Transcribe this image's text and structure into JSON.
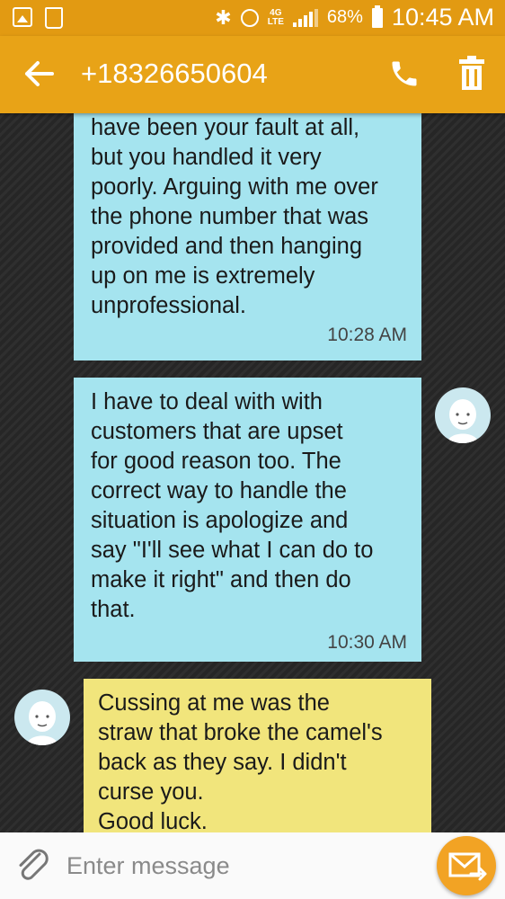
{
  "status_bar": {
    "battery": "68%",
    "time": "10:45 AM",
    "network": "4G LTE"
  },
  "header": {
    "contact": "+18326650604"
  },
  "messages": [
    {
      "direction": "sent",
      "text": "have been your fault at all,\nbut you handled it very\npoorly. Arguing with me over\nthe phone number that was\nprovided and then hanging\nup on me is extremely\nunprofessional.",
      "time": "10:28 AM"
    },
    {
      "direction": "sent",
      "text": "I have to deal with with\ncustomers  that are upset\nfor good reason too. The\ncorrect way to handle the\nsituation is apologize and\nsay \"I'll see what I can do to\nmake it right\" and then do\nthat.",
      "time": "10:30 AM"
    },
    {
      "direction": "received",
      "text": "Cussing at me was the\nstraw that broke the camel's\nback as they say. I didn't\ncurse you.\nGood luck.",
      "time": ""
    }
  ],
  "composer": {
    "placeholder": "Enter message"
  },
  "colors": {
    "status_bar": "#e29a12",
    "app_bar": "#e8a317",
    "sent_bubble": "#a5e4ef",
    "received_bubble": "#f1e57c",
    "send_button": "#f2a324"
  }
}
